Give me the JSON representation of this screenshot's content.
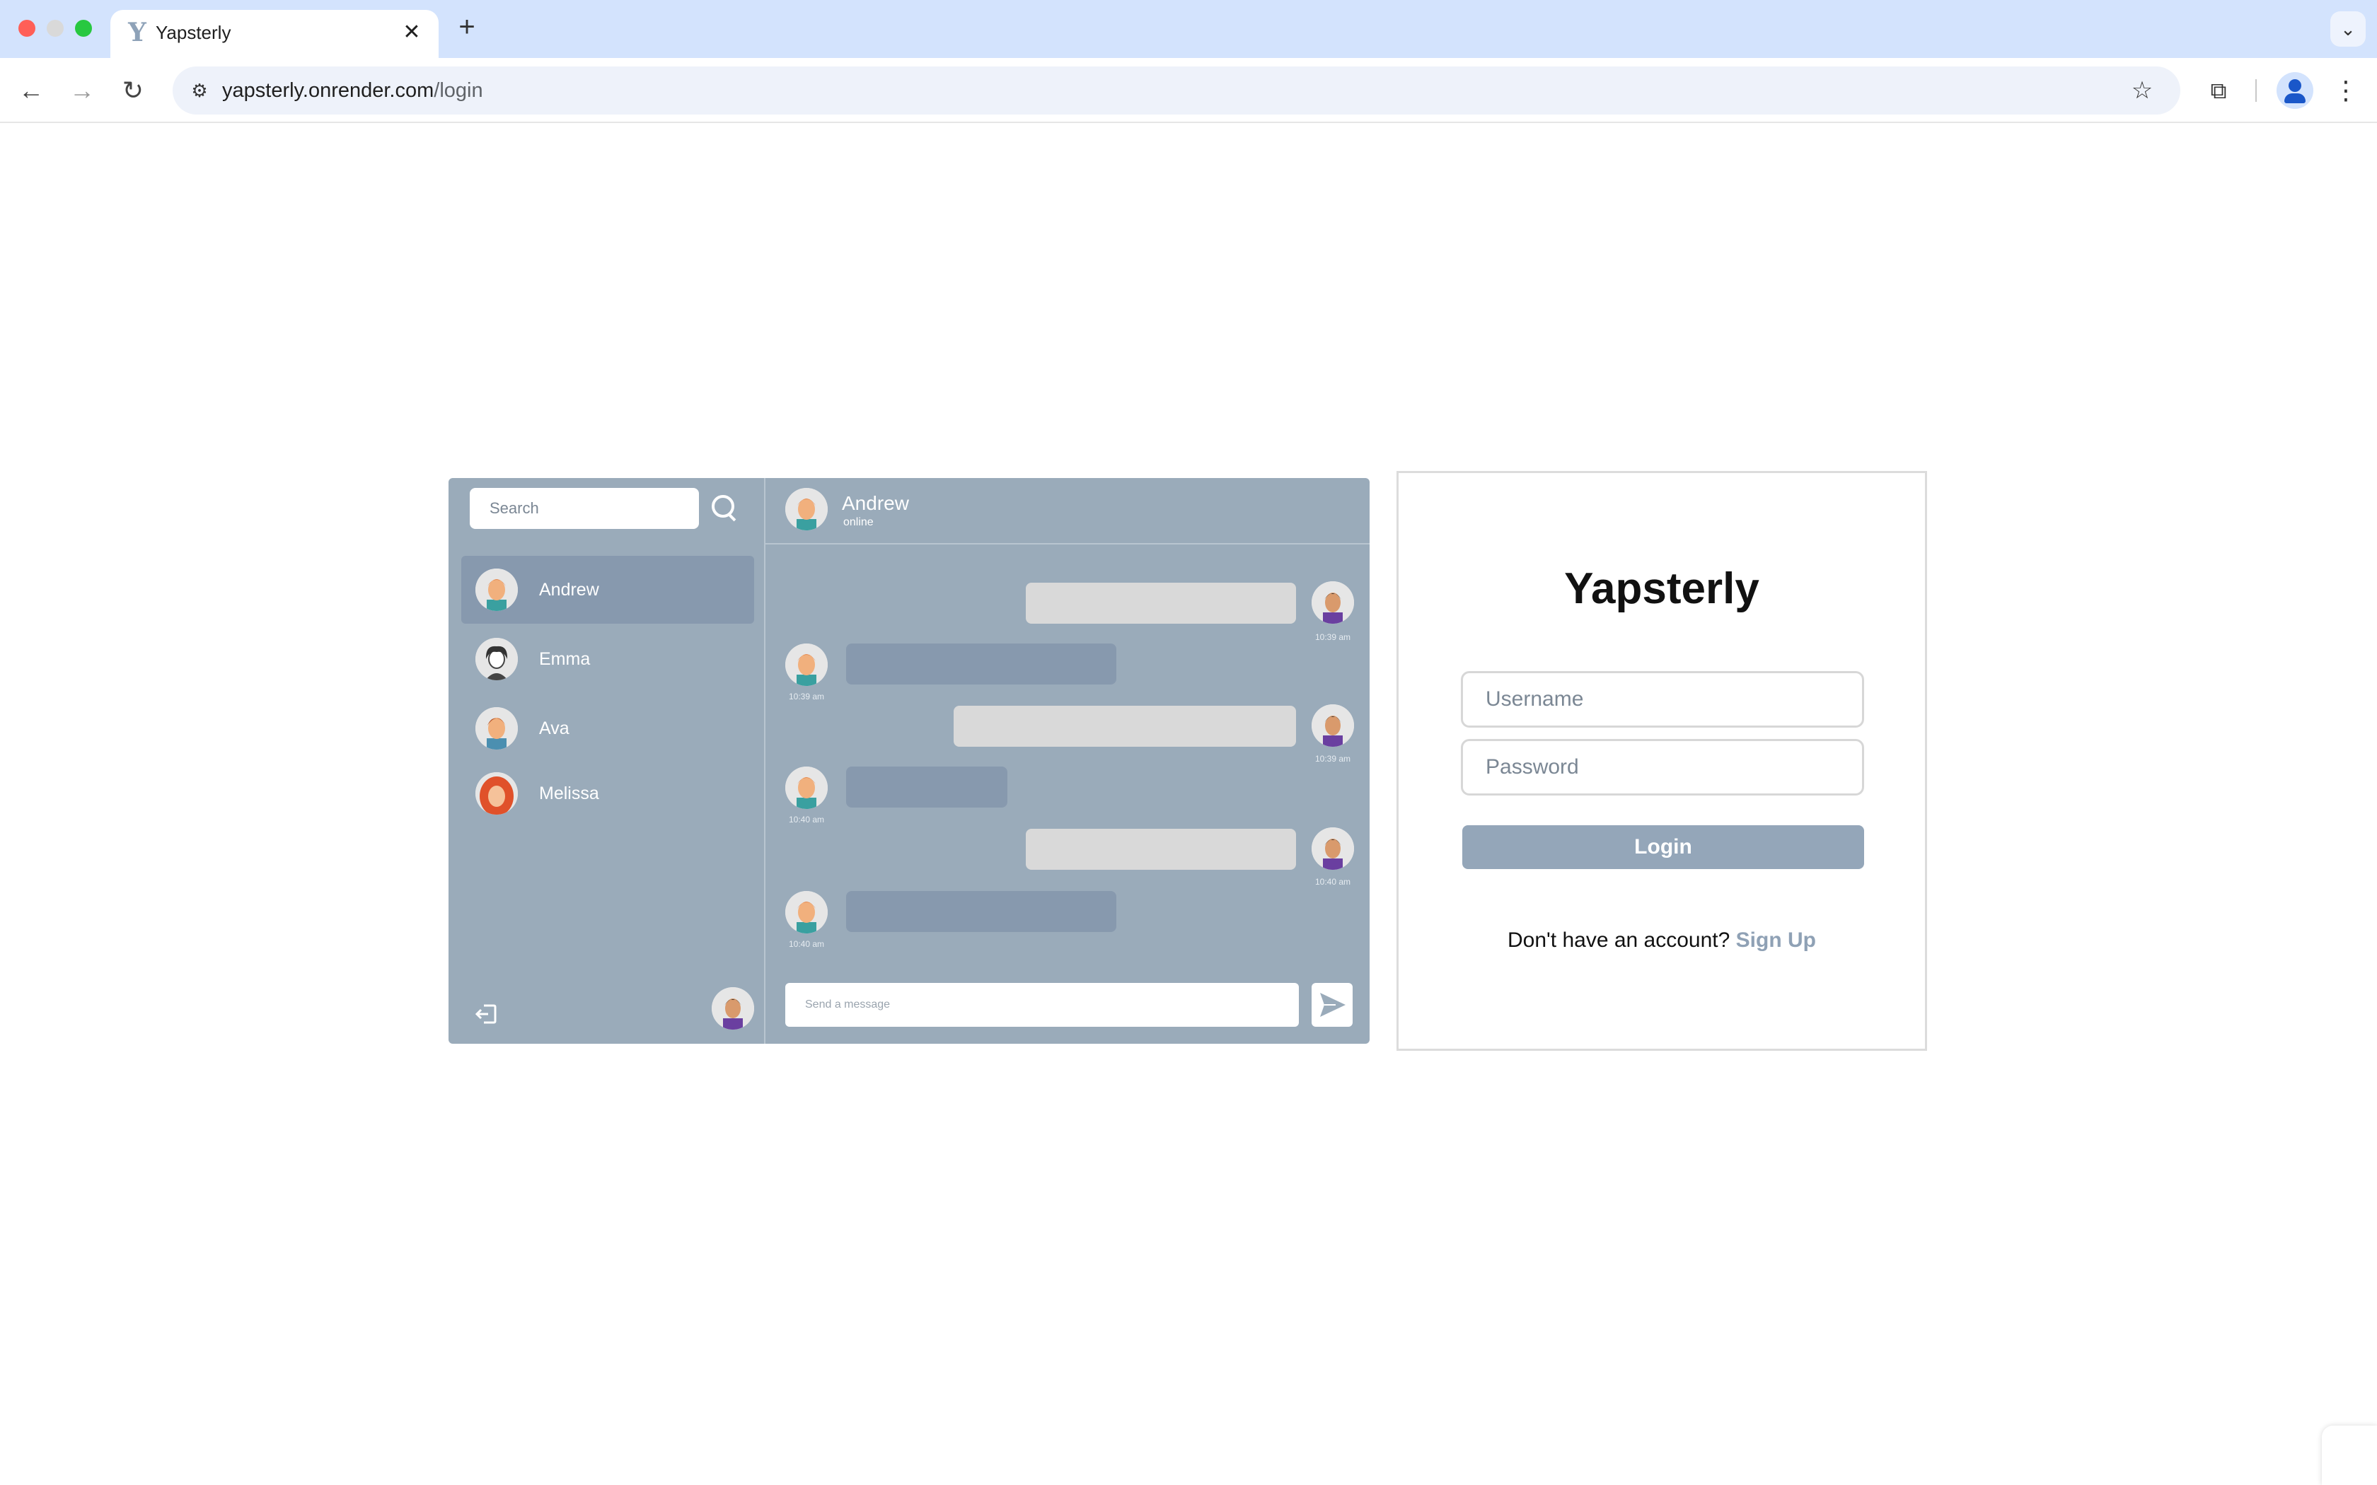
{
  "browser": {
    "tab_title": "Yapsterly",
    "tab_favicon_letter": "Y",
    "url_domain": "yapsterly.onrender.com",
    "url_path": "/login"
  },
  "mockup": {
    "search_placeholder": "Search",
    "contacts": [
      {
        "name": "Andrew",
        "active": true
      },
      {
        "name": "Emma",
        "active": false
      },
      {
        "name": "Ava",
        "active": false
      },
      {
        "name": "Melissa",
        "active": false
      }
    ],
    "chat_header": {
      "name": "Andrew",
      "status": "online"
    },
    "messages": [
      {
        "side": "out",
        "time": "10:39 am"
      },
      {
        "side": "in",
        "time": "10:39 am"
      },
      {
        "side": "out",
        "time": "10:39 am"
      },
      {
        "side": "in",
        "time": "10:40 am"
      },
      {
        "side": "out",
        "time": "10:40 am"
      },
      {
        "side": "in",
        "time": "10:40 am"
      }
    ],
    "message_placeholder": "Send a message"
  },
  "login": {
    "brand": "Yapsterly",
    "username_placeholder": "Username",
    "password_placeholder": "Password",
    "login_label": "Login",
    "signup_prompt": "Don't have an account?",
    "signup_link": "Sign Up"
  },
  "colors": {
    "tabstrip": "#d3e3fd",
    "mock_bg": "#9aabba",
    "accent": "#94a6b9"
  }
}
